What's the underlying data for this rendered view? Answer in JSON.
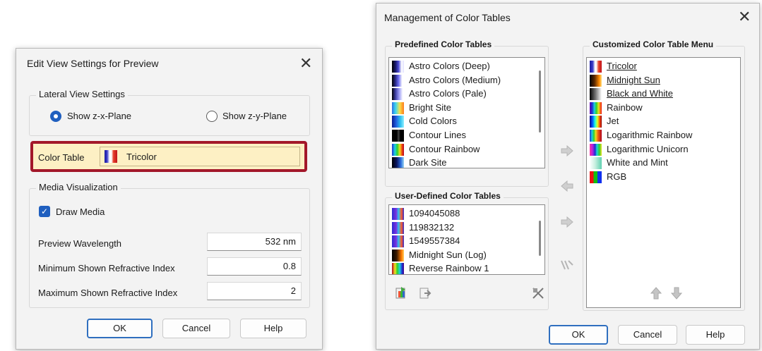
{
  "left_dialog": {
    "title": "Edit View Settings for Preview",
    "close_glyph": "✕",
    "lateral": {
      "legend": "Lateral View Settings",
      "option_zx": "Show z-x-Plane",
      "option_zy": "Show z-y-Plane",
      "selected": "Show z-x-Plane"
    },
    "color_table": {
      "label": "Color Table",
      "value": "Tricolor"
    },
    "media": {
      "legend": "Media Visualization",
      "draw_media_label": "Draw Media",
      "draw_media_checked": true,
      "wavelength_label": "Preview Wavelength",
      "wavelength_value": "532 nm",
      "min_label": "Minimum Shown Refractive Index",
      "min_value": "0.8",
      "max_label": "Maximum Shown Refractive Index",
      "max_value": "2"
    },
    "buttons": {
      "ok": "OK",
      "cancel": "Cancel",
      "help": "Help"
    },
    "highlight_color": "#a3182a"
  },
  "right_dialog": {
    "title": "Management of Color Tables",
    "close_glyph": "✕",
    "predefined": {
      "legend": "Predefined Color Tables",
      "items": [
        {
          "label": "Astro Colors (Deep)",
          "icon": "astro-deep-swatch"
        },
        {
          "label": "Astro Colors (Medium)",
          "icon": "astro-medium-swatch"
        },
        {
          "label": "Astro Colors (Pale)",
          "icon": "astro-pale-swatch"
        },
        {
          "label": "Bright Site",
          "icon": "bright-site-swatch"
        },
        {
          "label": "Cold Colors",
          "icon": "cold-colors-swatch"
        },
        {
          "label": "Contour Lines",
          "icon": "contour-lines-swatch"
        },
        {
          "label": "Contour Rainbow",
          "icon": "contour-rainbow-swatch"
        },
        {
          "label": "Dark Site",
          "icon": "dark-site-swatch"
        }
      ]
    },
    "user_defined": {
      "legend": "User-Defined Color Tables",
      "items": [
        {
          "label": "1094045088",
          "icon": "user-table-swatch"
        },
        {
          "label": "119832132",
          "icon": "user-table-swatch"
        },
        {
          "label": "1549557384",
          "icon": "user-table-swatch"
        },
        {
          "label": "Midnight Sun (Log)",
          "icon": "midnight-sun-log-swatch"
        },
        {
          "label": "Reverse Rainbow 1",
          "icon": "reverse-rainbow-swatch"
        }
      ]
    },
    "customized": {
      "legend": "Customized Color Table Menu",
      "items": [
        {
          "label": "Tricolor",
          "underlined": true,
          "icon": "tricolor-swatch"
        },
        {
          "label": "Midnight Sun",
          "underlined": true,
          "icon": "midnight-sun-swatch"
        },
        {
          "label": "Black and White",
          "underlined": true,
          "icon": "black-white-swatch"
        },
        {
          "label": "Rainbow",
          "underlined": false,
          "icon": "rainbow-swatch"
        },
        {
          "label": "Jet",
          "underlined": false,
          "icon": "jet-swatch"
        },
        {
          "label": "Logarithmic Rainbow",
          "underlined": false,
          "icon": "log-rainbow-swatch"
        },
        {
          "label": "Logarithmic Unicorn",
          "underlined": false,
          "icon": "log-unicorn-swatch"
        },
        {
          "label": "White and Mint",
          "underlined": false,
          "icon": "white-mint-swatch"
        },
        {
          "label": "RGB",
          "underlined": false,
          "icon": "rgb-swatch"
        }
      ]
    },
    "buttons": {
      "ok": "OK",
      "cancel": "Cancel",
      "help": "Help"
    }
  }
}
